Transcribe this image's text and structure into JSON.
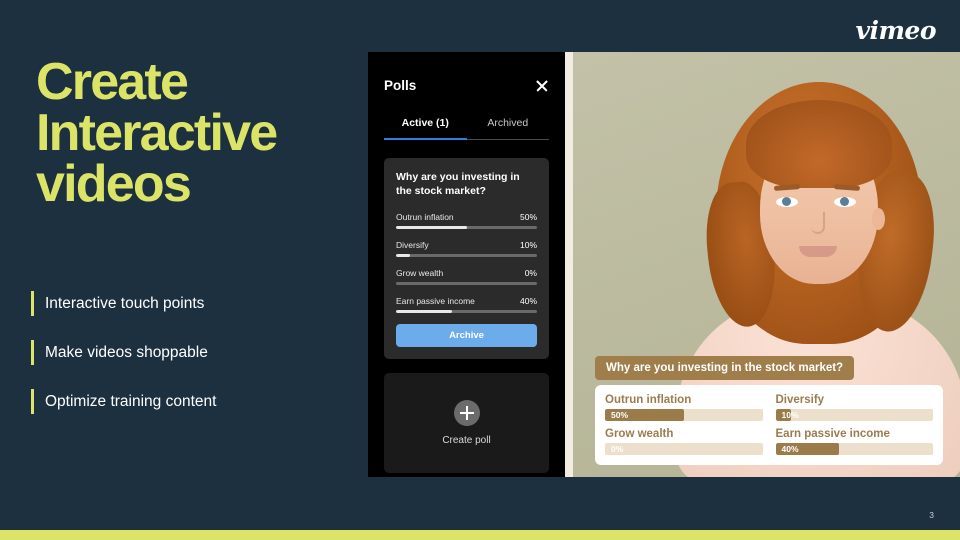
{
  "brand": {
    "logo_text": "vimeo",
    "accent_color": "#dce468",
    "background_color": "#1c3040"
  },
  "slide": {
    "headline_lines": [
      "Create",
      "Interactive",
      "videos"
    ],
    "bullets": [
      {
        "label": "Interactive touch points"
      },
      {
        "label": "Make videos shoppable"
      },
      {
        "label": "Optimize training content"
      }
    ],
    "page_number": "3"
  },
  "polls_panel": {
    "title": "Polls",
    "close_label": "×",
    "tabs": [
      {
        "label": "Active (1)",
        "active": true
      },
      {
        "label": "Archived",
        "active": false
      }
    ],
    "poll": {
      "question": "Why are you investing in the stock market?",
      "options": [
        {
          "name": "Outrun inflation",
          "percent_label": "50%",
          "percent": 50
        },
        {
          "name": "Diversify",
          "percent_label": "10%",
          "percent": 10
        },
        {
          "name": "Grow wealth",
          "percent_label": "0%",
          "percent": 0
        },
        {
          "name": "Earn passive income",
          "percent_label": "40%",
          "percent": 40
        }
      ],
      "archive_button": "Archive"
    },
    "create_poll": {
      "label": "Create poll",
      "icon": "plus-icon"
    }
  },
  "video_overlay": {
    "question": "Why are you investing in the stock market?",
    "options": [
      {
        "name": "Outrun inflation",
        "percent_label": "50%",
        "percent": 50
      },
      {
        "name": "Diversify",
        "percent_label": "10%",
        "percent": 10
      },
      {
        "name": "Grow wealth",
        "percent_label": "0%",
        "percent": 0
      },
      {
        "name": "Earn passive income",
        "percent_label": "40%",
        "percent": 40
      }
    ],
    "question_bg_color": "#a07e4c",
    "bar_fill_color": "#9c7b4a",
    "bar_track_color": "#ece0cc"
  }
}
